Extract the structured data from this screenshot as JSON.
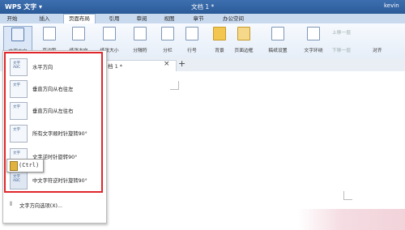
{
  "title_bar": {
    "app_name": "WPS 文字",
    "app_dropdown": "▾",
    "document_title": "文档 1 *",
    "user": "kevin"
  },
  "menu_tabs": [
    "开始",
    "插入",
    "页面布局",
    "引用",
    "审阅",
    "视图",
    "章节",
    "办公空间"
  ],
  "active_menu_tab": "页面布局",
  "ribbon": {
    "buttons": [
      "文字方向",
      "页边距",
      "纸张方向",
      "纸张大小",
      "分隔符",
      "分栏",
      "行号",
      "背景",
      "页面边框",
      "稿纸设置",
      "文字环绕",
      "上移一层",
      "下移一层",
      "对齐"
    ],
    "dropdown_arrows": "▾"
  },
  "doc_tab": {
    "label": "档 1 *",
    "close": "×",
    "new_tab": "+"
  },
  "text_direction_menu": {
    "items": [
      {
        "label": "水平方向",
        "icon": "horizontal-text-icon",
        "thumb": "文字ABC"
      },
      {
        "label": "垂直方向从右往左",
        "icon": "vertical-rtl-icon",
        "thumb": "文字"
      },
      {
        "label": "垂直方向从左往右",
        "icon": "vertical-ltr-icon",
        "thumb": "文字"
      },
      {
        "label": "所有文字顺时针旋转90°",
        "icon": "rotate-cw-icon",
        "thumb": "文字"
      },
      {
        "label": "文字逆时针旋转90°",
        "icon": "rotate-ccw-icon",
        "thumb": "文字"
      },
      {
        "label": "中文字符逆时针旋转90°",
        "icon": "chinese-rotate-icon",
        "thumb": "文字ABC"
      }
    ],
    "options_label": "文字方向选项(X)..."
  },
  "paste_ctrl_label": "(Ctrl)",
  "colors": {
    "title_bar": "#2f5fa0",
    "highlight_box": "#e0262b",
    "ribbon_bg": "#eef3fa"
  }
}
